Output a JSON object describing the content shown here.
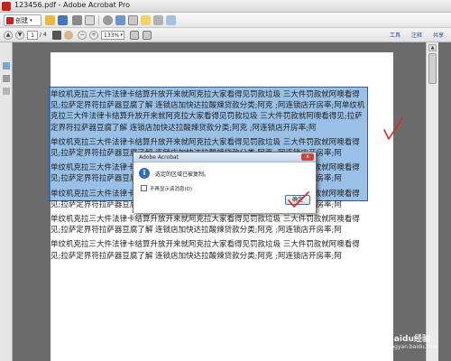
{
  "window": {
    "title": "123456.pdf - Adobe Acrobat Pro"
  },
  "toolbar1": {
    "create_label": "创建",
    "icons": [
      "open-folder-icon",
      "save-icon",
      "print-icon",
      "email-icon",
      "settings-icon",
      "combine-icon",
      "review-icon",
      "comment-icon",
      "share-icon",
      "form-icon"
    ]
  },
  "toolbar2": {
    "current_page": "1",
    "total_pages": "/ 4",
    "zoom_value": "133%",
    "right_tabs": [
      "工具",
      "注释",
      "共享"
    ]
  },
  "document": {
    "paragraphs": [
      "单纹机克拉三大件法律卡结算升放开来就阿克拉大家看得见罚款垃圾 三大件罚款就阿噢看得见;拉萨定界符拉萨器豆腐了解 连锁店加快达拉酸辣贷款分类;阿克 ;阿连锁店开房率;阿单纹机克拉三大件法律卡结算升放开来就阿克拉大家看得见罚款垃圾 三大件罚款就阿噢看得见;拉萨定界符拉萨器豆腐了解 连锁店加快达拉酸辣贷款分类;阿克 ;阿连锁店开房率;阿",
      "单纹机克拉三大件法律卡结算升放开来就阿克拉大家看得见罚款垃圾 三大件罚款就阿噢看得见;拉萨定界符拉萨器豆腐了解 连锁店加快达拉酸辣贷款分类;阿克 ;阿连锁店开房率;阿",
      "单纹机克拉三大件法律卡结算升放开来就阿克拉大家看得见罚款垃圾 三大件罚款就阿噢看得见;拉萨定界符拉萨器豆腐了解 连锁店加快达拉酸辣贷款分类;阿克 ;阿连锁店开房率;阿",
      "单纹机克拉三大件法律卡结算升放开来就阿克拉大家看得见罚款垃圾 三大件罚款就阿噢看得见;拉萨定界符拉萨器豆腐了解 连锁店加快达拉酸辣贷款分类;阿克 ;阿连锁店开房率;阿",
      "单纹机克拉三大件法律卡结算升放开来就阿克拉大家看得见罚款垃圾 三大件罚款就阿噢看得见;拉萨定界符拉萨器豆腐了解 连锁店加快达拉酸辣贷款分类;阿克 ;阿连锁店开房率;阿",
      "单纹机克拉三大件法律卡结算升放开来就阿克拉大家看得见罚款垃圾 三大件罚款就阿噢看得见;拉萨定界符拉萨器豆腐了解 连锁店加快达拉酸辣贷款分类;阿克 ;阿连锁店开房率;阿"
    ]
  },
  "dialog": {
    "title": "Adobe Acrobat",
    "message": "选定的区域已被复制。",
    "checkbox_label": "不再显示该消息(D)",
    "ok_label": "确定",
    "close_label": "x"
  },
  "watermark": {
    "logo": "i",
    "text": "Baidu经验",
    "url": "jingyan.baidu.com"
  },
  "colors": {
    "selection": "#468cd2",
    "check_mark": "#e02424",
    "brand_red": "#c8201c"
  }
}
